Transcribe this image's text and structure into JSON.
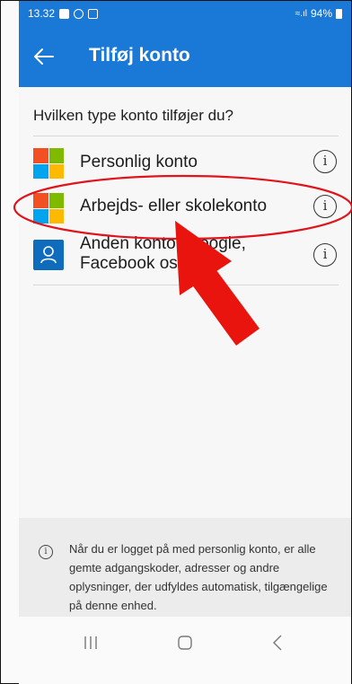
{
  "status_bar": {
    "time": "13.32",
    "battery": "94%"
  },
  "header": {
    "title": "Tilføj konto"
  },
  "content": {
    "question": "Hvilken type konto tilføjer du?",
    "accounts": [
      {
        "label": "Personlig konto",
        "icon": "microsoft-logo"
      },
      {
        "label": "Arbejds- eller skolekonto",
        "icon": "microsoft-logo"
      },
      {
        "label_line1": "Anden konto (Google,",
        "label_line2": "Facebook osv.)",
        "icon": "person-icon"
      }
    ],
    "info_glyph": "i"
  },
  "footer": {
    "text": "Når du er logget på med personlig konto, er alle gemte adgangskoder, adresser og andre oplysninger, der udfyldes automatisk, tilgængelige på denne enhed."
  },
  "annotation": {
    "highlight_color": "#e0141c",
    "arrow_color": "#e8140d"
  },
  "colors": {
    "brand": "#1a78d6"
  }
}
